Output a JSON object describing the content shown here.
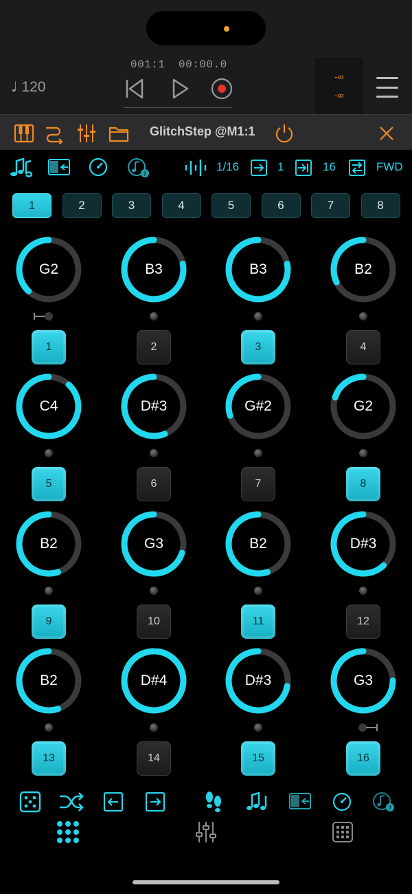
{
  "host": {
    "tempo": "120",
    "tempo_note": "♩",
    "position_bars": "001:1",
    "position_time": "00:00.0",
    "meter_top": "-∞",
    "meter_bottom": "-∞"
  },
  "plugin": {
    "title": "GlitchStep @M1:1"
  },
  "toolbar": {
    "rate": "1/16",
    "start": "1",
    "end": "16",
    "direction": "FWD"
  },
  "patterns": [
    "1",
    "2",
    "3",
    "4",
    "5",
    "6",
    "7",
    "8"
  ],
  "active_pattern": 0,
  "steps": [
    {
      "number": "1",
      "note": "G2",
      "level": 0.38,
      "on": true
    },
    {
      "number": "2",
      "note": "B3",
      "level": 0.78,
      "on": false
    },
    {
      "number": "3",
      "note": "B3",
      "level": 0.78,
      "on": true
    },
    {
      "number": "4",
      "note": "B2",
      "level": 0.32,
      "on": false
    },
    {
      "number": "5",
      "note": "C4",
      "level": 0.88,
      "on": true
    },
    {
      "number": "6",
      "note": "D#3",
      "level": 0.56,
      "on": false
    },
    {
      "number": "7",
      "note": "G#2",
      "level": 0.3,
      "on": false
    },
    {
      "number": "8",
      "note": "G2",
      "level": 0.2,
      "on": true
    },
    {
      "number": "9",
      "note": "B2",
      "level": 0.55,
      "on": true
    },
    {
      "number": "10",
      "note": "G3",
      "level": 0.7,
      "on": false
    },
    {
      "number": "11",
      "note": "B2",
      "level": 0.55,
      "on": true
    },
    {
      "number": "12",
      "note": "D#3",
      "level": 0.62,
      "on": false
    },
    {
      "number": "13",
      "note": "B2",
      "level": 0.55,
      "on": true
    },
    {
      "number": "14",
      "note": "D#4",
      "level": 0.98,
      "on": false
    },
    {
      "number": "15",
      "note": "D#3",
      "level": 0.72,
      "on": true
    },
    {
      "number": "16",
      "note": "G3",
      "level": 0.75,
      "on": true
    }
  ],
  "colors": {
    "accent": "#22d8ee",
    "track": "#3a3a3c",
    "orange": "#f08a24"
  }
}
